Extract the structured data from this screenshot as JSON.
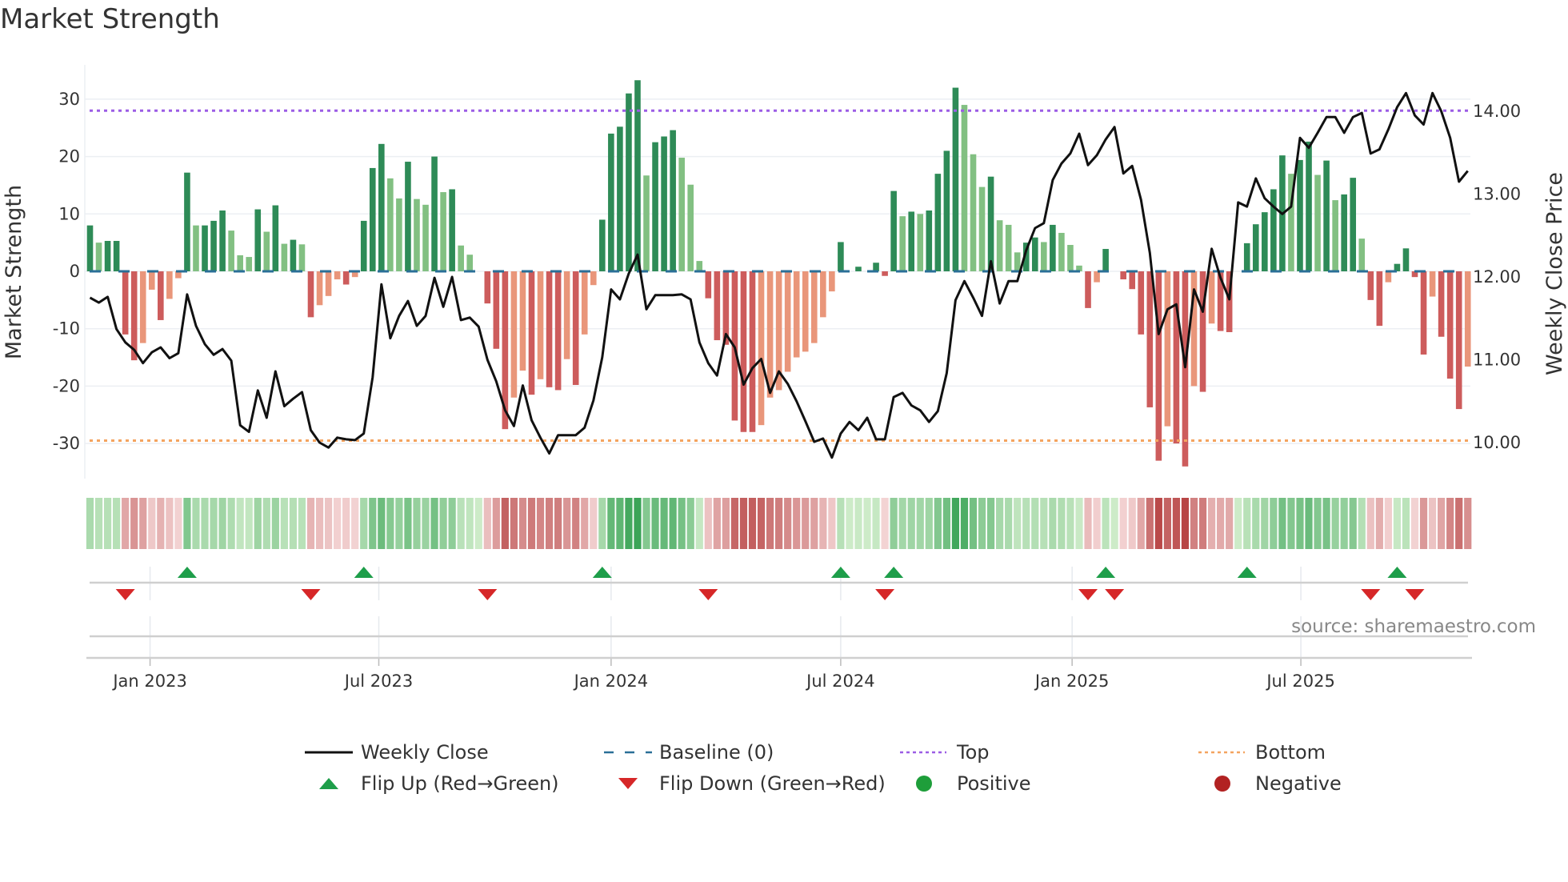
{
  "title": "Market Strength",
  "source": "source: sharemaestro.com",
  "chart_data": {
    "type": "bar",
    "title": "Market Strength",
    "ylabel": "Market Strength",
    "y2label": "Weekly Close Price",
    "ylim": [
      -36,
      36
    ],
    "y2lim": [
      9.5,
      14.5
    ],
    "yticks": [
      30,
      20,
      10,
      0,
      -10,
      -20,
      -30
    ],
    "y2ticks": [
      "14.00",
      "13.00",
      "12.00",
      "11.00",
      "10.00"
    ],
    "xticks": [
      {
        "label": "Jan 2023",
        "week": 6.8
      },
      {
        "label": "Jul 2023",
        "week": 32.7
      },
      {
        "label": "Jan 2024",
        "week": 59
      },
      {
        "label": "Jul 2024",
        "week": 85
      },
      {
        "label": "Jan 2025",
        "week": 111.2
      },
      {
        "label": "Jul 2025",
        "week": 137.1
      }
    ],
    "top_level": 28,
    "bottom_level": -29.5,
    "strength": [
      8,
      5,
      5.3,
      5.3,
      -11,
      -15.5,
      -12.5,
      -3.2,
      -8.5,
      -4.8,
      -1.2,
      17.2,
      8,
      8,
      8.8,
      10.6,
      7.1,
      2.8,
      2.5,
      10.8,
      6.9,
      11.5,
      4.8,
      5.5,
      4.7,
      -8,
      -5.9,
      -4.3,
      -1.4,
      -2.3,
      -1,
      8.8,
      18,
      22.2,
      16.2,
      12.7,
      19.1,
      12.6,
      11.6,
      20,
      13.8,
      14.3,
      4.5,
      2.9,
      0,
      -5.6,
      -13.5,
      -27.5,
      -22,
      -17.3,
      -21.5,
      -18.8,
      -20.2,
      -20.7,
      -15.3,
      -19.8,
      -11,
      -2.4,
      9,
      24,
      25.2,
      31,
      33.3,
      16.7,
      22.5,
      23.5,
      24.6,
      19.8,
      15.1,
      1.8,
      -4.7,
      -12,
      -12.8,
      -26,
      -28,
      -28,
      -26.8,
      -22,
      -20.7,
      -17.5,
      -15,
      -14,
      -12.5,
      -8,
      -3.5,
      5.1,
      0,
      0.8,
      0,
      1.5,
      -0.8,
      14,
      9.6,
      10.4,
      10,
      10.6,
      17,
      21,
      32,
      29,
      20.4,
      14.7,
      16.5,
      8.9,
      8.1,
      3.3,
      5,
      5.9,
      5.1,
      8.1,
      6.7,
      4.6,
      1,
      -6.4,
      -1.9,
      3.9,
      0,
      -1.4,
      -3.1,
      -11,
      -23.7,
      -33,
      -27,
      -30,
      -34,
      -20,
      -21,
      -9.1,
      -10.4,
      -10.6,
      0,
      4.9,
      8.2,
      10.3,
      14.3,
      20.2,
      17,
      19.4,
      22.6,
      16.8,
      19.3,
      12.4,
      13.4,
      16.3,
      5.7,
      -5,
      -9.5,
      -1.9,
      1.3,
      4,
      -1,
      -14.5,
      -4.4,
      -11.4,
      -18.7,
      -24,
      -16.6
    ],
    "weekly_close": [
      11.74,
      11.68,
      11.75,
      11.36,
      11.2,
      11.11,
      10.95,
      11.08,
      11.14,
      11.01,
      11.07,
      11.78,
      11.4,
      11.18,
      11.05,
      11.12,
      10.98,
      10.2,
      10.12,
      10.62,
      10.29,
      10.85,
      10.43,
      10.52,
      10.6,
      10.14,
      9.99,
      9.93,
      10.05,
      10.03,
      10.02,
      10.1,
      10.78,
      11.9,
      11.25,
      11.52,
      11.7,
      11.4,
      11.52,
      11.98,
      11.63,
      11.99,
      11.47,
      11.5,
      11.39,
      10.99,
      10.73,
      10.38,
      10.19,
      10.68,
      10.26,
      10.05,
      9.86,
      10.08,
      10.08,
      10.08,
      10.17,
      10.5,
      11.02,
      11.84,
      11.72,
      12.03,
      12.26,
      11.6,
      11.77,
      11.77,
      11.77,
      11.78,
      11.72,
      11.2,
      10.95,
      10.8,
      11.3,
      11.14,
      10.69,
      10.89,
      11.0,
      10.59,
      10.85,
      10.7,
      10.49,
      10.25,
      10.0,
      10.04,
      9.81,
      10.1,
      10.24,
      10.14,
      10.29,
      10.03,
      10.03,
      10.54,
      10.59,
      10.44,
      10.38,
      10.24,
      10.37,
      10.83,
      11.71,
      11.94,
      11.74,
      11.52,
      12.18,
      11.67,
      11.94,
      11.94,
      12.31,
      12.58,
      12.64,
      13.16,
      13.36,
      13.48,
      13.72,
      13.34,
      13.46,
      13.65,
      13.8,
      13.24,
      13.33,
      12.92,
      12.28,
      11.3,
      11.6,
      11.66,
      10.9,
      11.84,
      11.57,
      12.33,
      11.98,
      11.72,
      12.89,
      12.84,
      13.18,
      12.94,
      12.84,
      12.75,
      12.84,
      13.67,
      13.55,
      13.73,
      13.92,
      13.92,
      13.73,
      13.92,
      13.97,
      13.48,
      13.53,
      13.77,
      14.04,
      14.21,
      13.94,
      13.83,
      14.21,
      13.99,
      13.67,
      13.14,
      13.27
    ],
    "flip_up_weeks": [
      11,
      31,
      58,
      85,
      91,
      115,
      131,
      148
    ],
    "flip_down_weeks": [
      4,
      25,
      45,
      70,
      90,
      113,
      116,
      145,
      150
    ],
    "colors": {
      "green_strong": "#2e8b57",
      "green_weak": "#82c082",
      "red_strong": "#cd5c5c",
      "red_weak": "#e9967a",
      "baseline": "#2a6f97",
      "top": "#9b5de5",
      "bottom": "#f4a460",
      "flip_up": "#1e9e4a",
      "flip_down": "#d62728",
      "positive": "#1e9e3a",
      "negative": "#b22222"
    },
    "legend": [
      {
        "label": "Weekly Close",
        "kind": "line"
      },
      {
        "label": "Baseline (0)",
        "kind": "dash"
      },
      {
        "label": "Top",
        "kind": "dot-top"
      },
      {
        "label": "Bottom",
        "kind": "dot-bottom"
      },
      {
        "label": "Flip Up (Red→Green)",
        "kind": "up"
      },
      {
        "label": "Flip Down (Green→Red)",
        "kind": "down"
      },
      {
        "label": "Positive",
        "kind": "pos"
      },
      {
        "label": "Negative",
        "kind": "neg"
      }
    ]
  }
}
